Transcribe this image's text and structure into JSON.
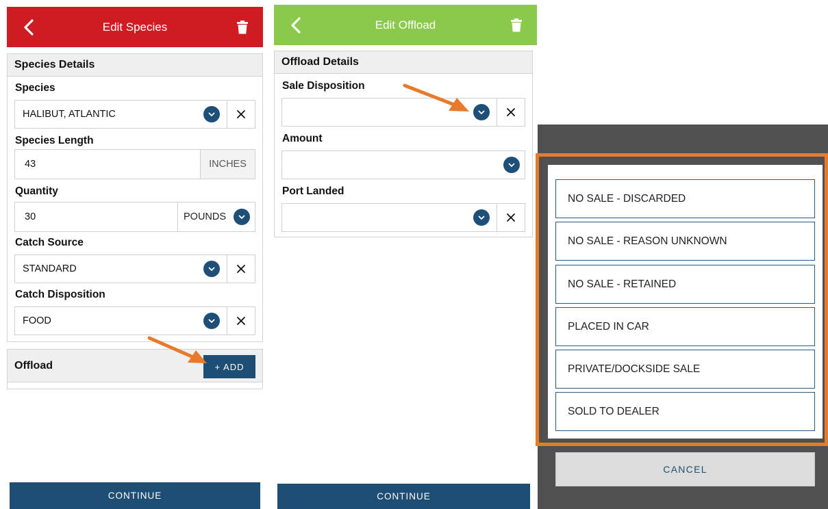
{
  "screen1": {
    "header": {
      "title": "Edit Species",
      "color": "#cf1b22"
    },
    "panel_title": "Species Details",
    "species": {
      "label": "Species",
      "value": "HALIBUT, ATLANTIC"
    },
    "length": {
      "label": "Species Length",
      "value": "43",
      "unit": "INCHES"
    },
    "quantity": {
      "label": "Quantity",
      "value": "30",
      "unit": "POUNDS"
    },
    "catch_source": {
      "label": "Catch Source",
      "value": "STANDARD"
    },
    "catch_disposition": {
      "label": "Catch Disposition",
      "value": "FOOD"
    },
    "offload": {
      "title": "Offload",
      "add_label": "+ ADD"
    },
    "continue_label": "CONTINUE"
  },
  "screen2": {
    "header": {
      "title": "Edit Offload",
      "color": "#8bc94d"
    },
    "panel_title": "Offload Details",
    "sale_disposition": {
      "label": "Sale Disposition",
      "value": ""
    },
    "amount": {
      "label": "Amount",
      "value": ""
    },
    "port_landed": {
      "label": "Port Landed",
      "value": ""
    },
    "continue_label": "CONTINUE"
  },
  "picker": {
    "options": [
      "NO SALE - DISCARDED",
      "NO SALE - REASON UNKNOWN",
      "NO SALE - RETAINED",
      "PLACED IN CAR",
      "PRIVATE/DOCKSIDE SALE",
      "SOLD TO DEALER"
    ],
    "cancel_label": "CANCEL",
    "highlight_color": "#e87a2b"
  },
  "colors": {
    "primary": "#1f4e74",
    "arrow": "#e87a2b"
  }
}
